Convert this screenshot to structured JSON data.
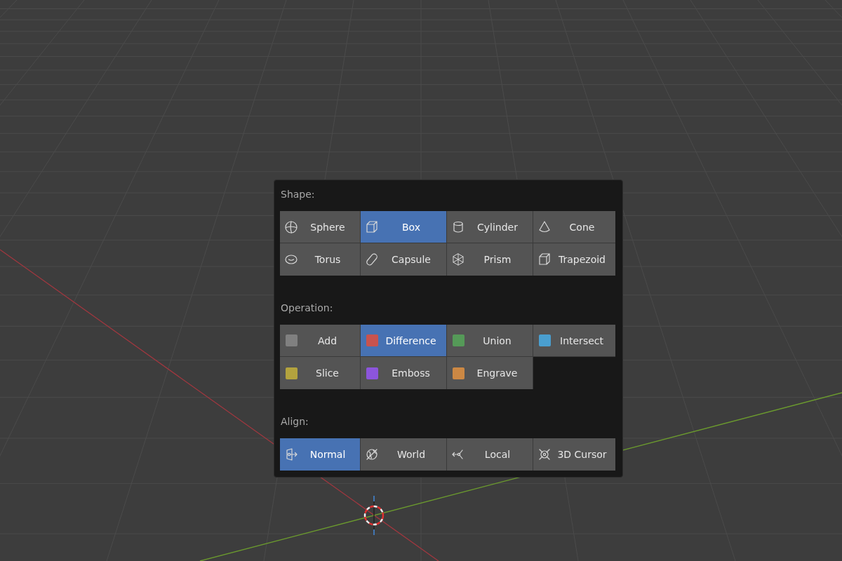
{
  "shape": {
    "label": "Shape:",
    "items": [
      {
        "label": "Sphere",
        "selected": false
      },
      {
        "label": "Box",
        "selected": true
      },
      {
        "label": "Cylinder",
        "selected": false
      },
      {
        "label": "Cone",
        "selected": false
      },
      {
        "label": "Torus",
        "selected": false
      },
      {
        "label": "Capsule",
        "selected": false
      },
      {
        "label": "Prism",
        "selected": false
      },
      {
        "label": "Trapezoid",
        "selected": false
      }
    ]
  },
  "operation": {
    "label": "Operation:",
    "items": [
      {
        "label": "Add",
        "selected": false,
        "color": "#808080"
      },
      {
        "label": "Difference",
        "selected": true,
        "color": "#c8534e"
      },
      {
        "label": "Union",
        "selected": false,
        "color": "#559a58"
      },
      {
        "label": "Intersect",
        "selected": false,
        "color": "#4a9fd0"
      },
      {
        "label": "Slice",
        "selected": false,
        "color": "#b3a33e"
      },
      {
        "label": "Emboss",
        "selected": false,
        "color": "#8c55dc"
      },
      {
        "label": "Engrave",
        "selected": false,
        "color": "#cc8844"
      }
    ]
  },
  "align": {
    "label": "Align:",
    "items": [
      {
        "label": "Normal",
        "selected": true
      },
      {
        "label": "World",
        "selected": false
      },
      {
        "label": "Local",
        "selected": false
      },
      {
        "label": "3D Cursor",
        "selected": false
      }
    ]
  }
}
